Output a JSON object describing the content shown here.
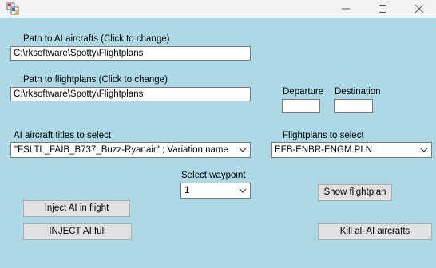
{
  "window": {
    "minimize_icon": "minimize-icon",
    "maximize_icon": "maximize-icon",
    "close_icon": "close-icon",
    "app_icon": "application-icon"
  },
  "paths": {
    "ai_label": "Path to AI aircrafts (Click to change)",
    "ai_value": "C:\\rksoftware\\Spotty\\Flightplans",
    "fp_label": "Path to flightplans (Click to change)",
    "fp_value": "C:\\rksoftware\\Spotty\\Flightplans"
  },
  "route": {
    "departure_label": "Departure",
    "departure_value": "",
    "destination_label": "Destination",
    "destination_value": ""
  },
  "aircraft": {
    "label": "AI aircraft titles to select",
    "selected": "\"FSLTL_FAIB_B737_Buzz-Ryanair\" ; Variation name"
  },
  "flightplans": {
    "label": "Flightplans to select",
    "selected": "EFB-ENBR-ENGM.PLN"
  },
  "waypoint": {
    "label": "Select waypoint",
    "selected": "1"
  },
  "buttons": {
    "show_flightplan": "Show flightplan",
    "inject_in_flight": "Inject AI in flight",
    "inject_full": "INJECT AI full",
    "kill_all": "Kill all AI aircrafts"
  },
  "colors": {
    "client_background": "#add8e6",
    "titlebar_background": "#f3f3f3",
    "button_face": "#e1e1e1"
  }
}
